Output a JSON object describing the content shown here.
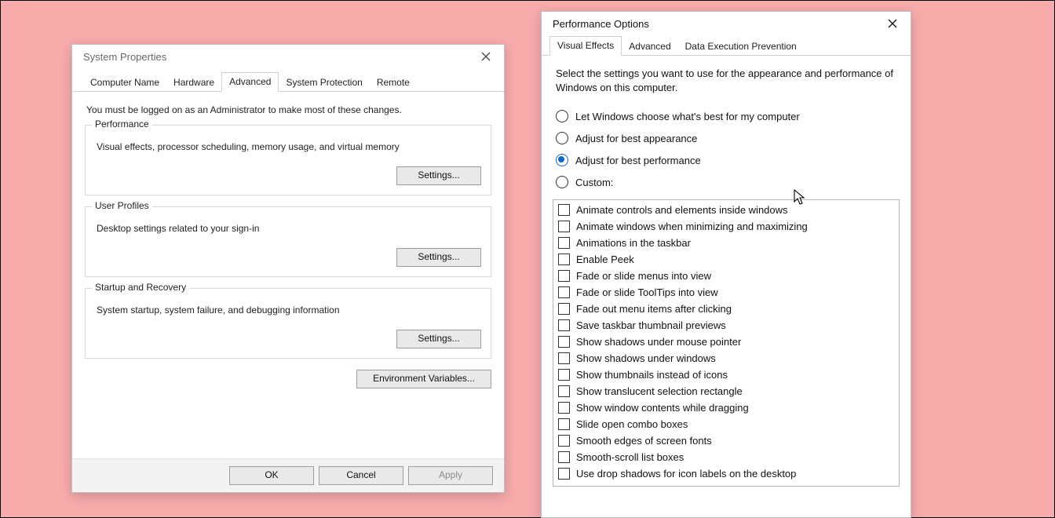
{
  "sys": {
    "title": "System Properties",
    "tabs": [
      "Computer Name",
      "Hardware",
      "Advanced",
      "System Protection",
      "Remote"
    ],
    "active_tab": 2,
    "admin_note": "You must be logged on as an Administrator to make most of these changes.",
    "groups": {
      "performance": {
        "legend": "Performance",
        "desc": "Visual effects, processor scheduling, memory usage, and virtual memory",
        "btn": "Settings..."
      },
      "profiles": {
        "legend": "User Profiles",
        "desc": "Desktop settings related to your sign-in",
        "btn": "Settings..."
      },
      "startup": {
        "legend": "Startup and Recovery",
        "desc": "System startup, system failure, and debugging information",
        "btn": "Settings..."
      }
    },
    "env_btn": "Environment Variables...",
    "footer": {
      "ok": "OK",
      "cancel": "Cancel",
      "apply": "Apply"
    }
  },
  "perf": {
    "title": "Performance Options",
    "tabs": [
      "Visual Effects",
      "Advanced",
      "Data Execution Prevention"
    ],
    "active_tab": 0,
    "desc": "Select the settings you want to use for the appearance and performance of Windows on this computer.",
    "radios": [
      {
        "label": "Let Windows choose what's best for my computer",
        "selected": false
      },
      {
        "label": "Adjust for best appearance",
        "selected": false
      },
      {
        "label": "Adjust for best performance",
        "selected": true
      },
      {
        "label": "Custom:",
        "selected": false
      }
    ],
    "checks": [
      "Animate controls and elements inside windows",
      "Animate windows when minimizing and maximizing",
      "Animations in the taskbar",
      "Enable Peek",
      "Fade or slide menus into view",
      "Fade or slide ToolTips into view",
      "Fade out menu items after clicking",
      "Save taskbar thumbnail previews",
      "Show shadows under mouse pointer",
      "Show shadows under windows",
      "Show thumbnails instead of icons",
      "Show translucent selection rectangle",
      "Show window contents while dragging",
      "Slide open combo boxes",
      "Smooth edges of screen fonts",
      "Smooth-scroll list boxes",
      "Use drop shadows for icon labels on the desktop"
    ]
  }
}
